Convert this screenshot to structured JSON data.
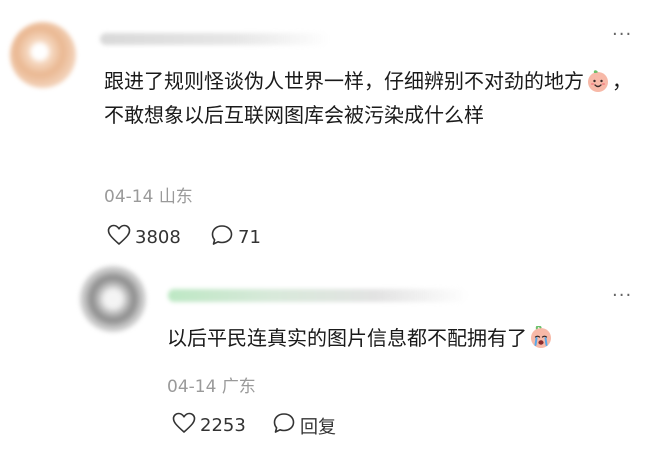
{
  "comment": {
    "text_part1": "跟进了规则怪谈伪人世界一样，仔细辨别不对劲的地方",
    "text_part2": "，不敢想象以后互联网图库会被污染成什么样",
    "emoji_icon": "smiling-peach-emoji",
    "date": "04-14",
    "location": "山东",
    "likes": "3808",
    "replies": "71",
    "more_icon": "more-dots-icon"
  },
  "reply": {
    "text": "以后平民连真实的图片信息都不配拥有了",
    "emoji_icon": "crying-face-emoji",
    "date": "04-14",
    "location": "广东",
    "likes": "2253",
    "reply_label": "回复",
    "more_icon": "more-dots-icon"
  },
  "colors": {
    "text": "#1a1a1a",
    "meta": "#9a9a9a",
    "background": "#ffffff"
  }
}
